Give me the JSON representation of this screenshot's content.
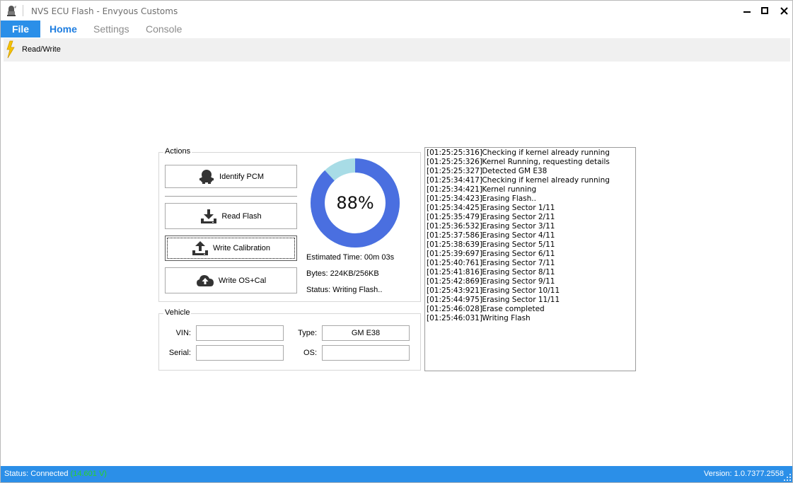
{
  "window": {
    "title": "NVS ECU Flash  - Envyous Customs"
  },
  "menu": {
    "file_label": "File",
    "tabs": [
      {
        "label": "Home",
        "active": true
      },
      {
        "label": "Settings",
        "active": false
      },
      {
        "label": "Console",
        "active": false
      }
    ]
  },
  "toolbar": {
    "read_write_label": "Read/Write",
    "icon": "lightning-bolt-icon"
  },
  "actions": {
    "group_title": "Actions",
    "identify_label": "Identify PCM",
    "read_label": "Read Flash",
    "write_cal_label": "Write Calibration",
    "write_os_label": "Write OS+Cal",
    "progress_percent": 88,
    "progress_text": "88%",
    "estimated_time": "Estimated Time: 00m 03s",
    "bytes": "Bytes: 224KB/256KB",
    "status": "Status: Writing Flash.."
  },
  "vehicle": {
    "group_title": "Vehicle",
    "vin_label": "VIN:",
    "vin_value": "",
    "serial_label": "Serial:",
    "serial_value": "",
    "type_label": "Type:",
    "type_value": "GM E38",
    "os_label": "OS:",
    "os_value": ""
  },
  "log": [
    {
      "time": "[01:25:25:316]",
      "msg": "Checking if kernel already running"
    },
    {
      "time": "[01:25:25:326]",
      "msg": "Kernel Running, requesting details"
    },
    {
      "time": "[01:25:25:327]",
      "msg": "Detected GM E38"
    },
    {
      "time": "[01:25:34:417]",
      "msg": "Checking if kernel already running"
    },
    {
      "time": "[01:25:34:421]",
      "msg": "Kernel running"
    },
    {
      "time": "[01:25:34:423]",
      "msg": "Erasing Flash.."
    },
    {
      "time": "[01:25:34:425]",
      "msg": "Erasing Sector 1/11"
    },
    {
      "time": "[01:25:35:479]",
      "msg": "Erasing Sector 2/11"
    },
    {
      "time": "[01:25:36:532]",
      "msg": "Erasing Sector 3/11"
    },
    {
      "time": "[01:25:37:586]",
      "msg": "Erasing Sector 4/11"
    },
    {
      "time": "[01:25:38:639]",
      "msg": "Erasing Sector 5/11"
    },
    {
      "time": "[01:25:39:697]",
      "msg": "Erasing Sector 6/11"
    },
    {
      "time": "[01:25:40:761]",
      "msg": "Erasing Sector 7/11"
    },
    {
      "time": "[01:25:41:816]",
      "msg": "Erasing Sector 8/11"
    },
    {
      "time": "[01:25:42:869]",
      "msg": "Erasing Sector 9/11"
    },
    {
      "time": "[01:25:43:921]",
      "msg": "Erasing Sector 10/11"
    },
    {
      "time": "[01:25:44:975]",
      "msg": "Erasing Sector 11/11"
    },
    {
      "time": "[01:25:46:028]",
      "msg": "Erase completed"
    },
    {
      "time": "[01:25:46:031]",
      "msg": "Writing Flash"
    }
  ],
  "statusbar": {
    "status_label": "Status: Connected",
    "voltage": "(14.601 V)",
    "version": "Version: 1.0.7377.2558"
  },
  "colors": {
    "accent": "#2b8fe8",
    "progress_fill": "#4a6fe0",
    "progress_track": "#a8dce6",
    "voltage": "#2ad22a"
  }
}
